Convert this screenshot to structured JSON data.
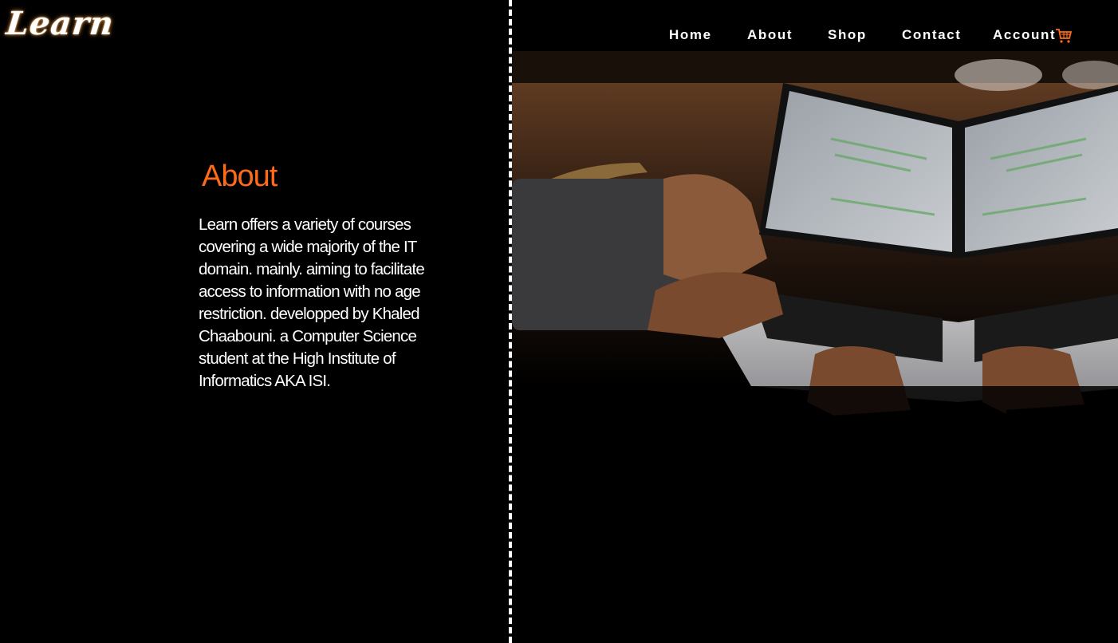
{
  "brand": {
    "logo_text": "Learn"
  },
  "nav": {
    "items": [
      {
        "label": "Home"
      },
      {
        "label": "About"
      },
      {
        "label": "Shop"
      },
      {
        "label": "Contact"
      },
      {
        "label": "Account"
      }
    ],
    "cart_icon": "shopping-cart-icon"
  },
  "about": {
    "title": "About",
    "text": "Learn offers a variety of courses covering a wide majority of the IT domain. mainly. aiming to facilitate access to information with no age restriction. developped by Khaled Chaabouni. a Computer Science student at the High Institute of Informatics AKA ISI."
  },
  "colors": {
    "accent": "#ff6a17",
    "background": "#000000",
    "text": "#ffffff"
  }
}
